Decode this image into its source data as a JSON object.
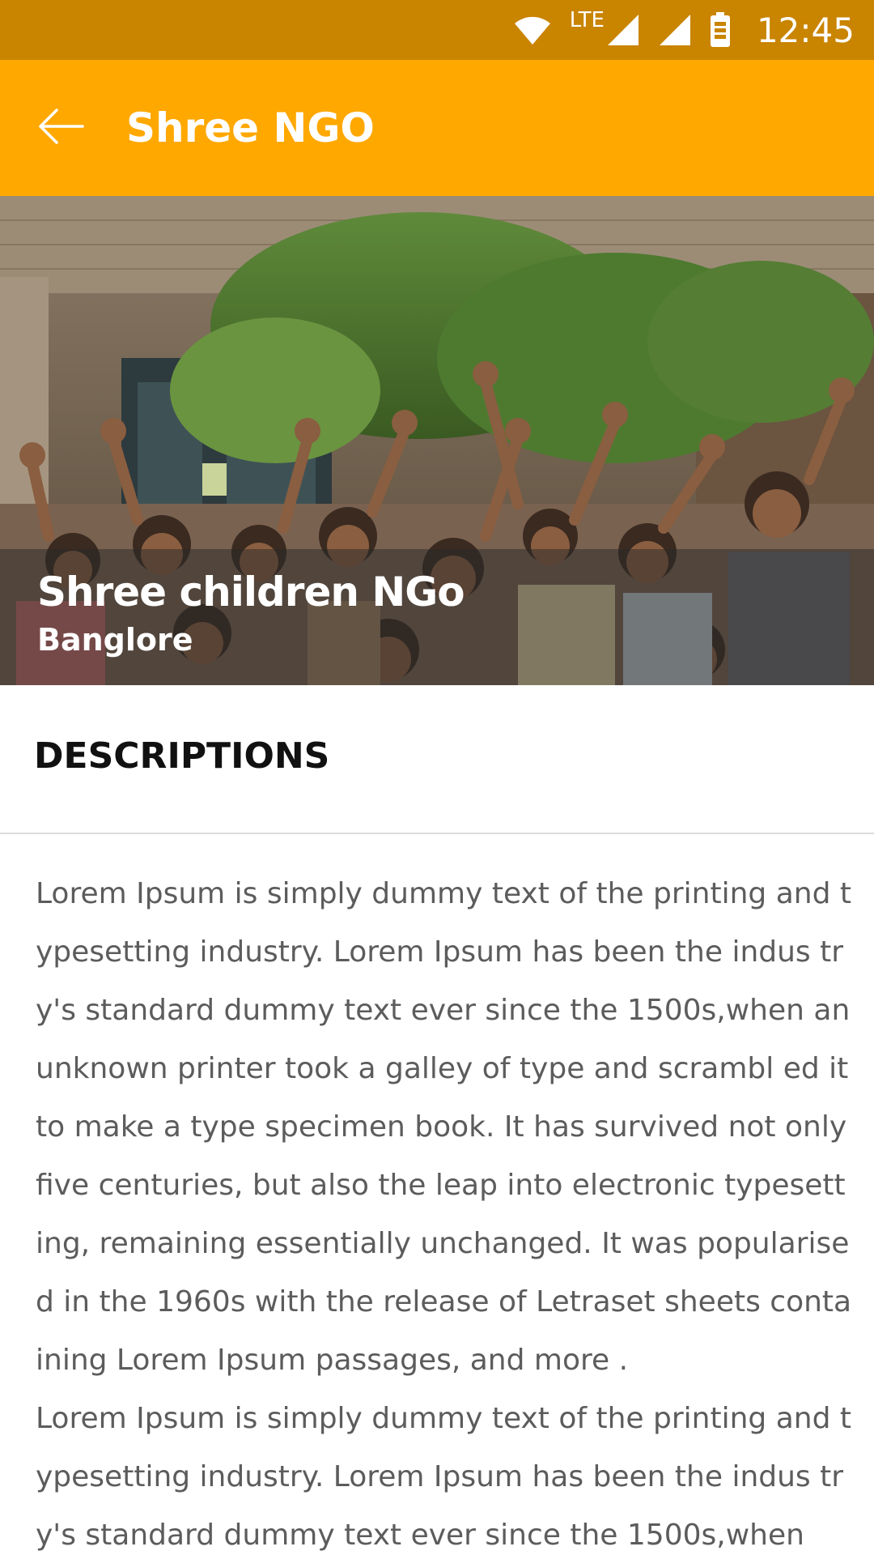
{
  "status_bar": {
    "network_label": "LTE",
    "time": "12:45",
    "icons": [
      "wifi-icon",
      "signal-icon",
      "battery-icon"
    ]
  },
  "app_bar": {
    "back_icon": "arrow-left-icon",
    "title": "Shree NGO",
    "background_color": "#FFA800"
  },
  "hero": {
    "title": "Shree children NGo",
    "subtitle": "Banglore"
  },
  "descriptions": {
    "header": "DESCRIPTIONS",
    "paragraphs": [
      "Lorem Ipsum is simply dummy text of the printing and typesetting industry. Lorem Ipsum has been the indus try's standard dummy text ever since the 1500s,when an unknown printer took a galley of type and scrambl ed it to make a type specimen book. It has survived not only five centuries, but also the leap into electronic typesetting, remaining essentially unchanged. It was popularised in the 1960s with the release of Letraset sheets containing Lorem Ipsum passages, and more .",
      "Lorem Ipsum is simply dummy text of the printing and typesetting industry. Lorem Ipsum has been the indus try's standard dummy text ever since the 1500s,when"
    ]
  }
}
